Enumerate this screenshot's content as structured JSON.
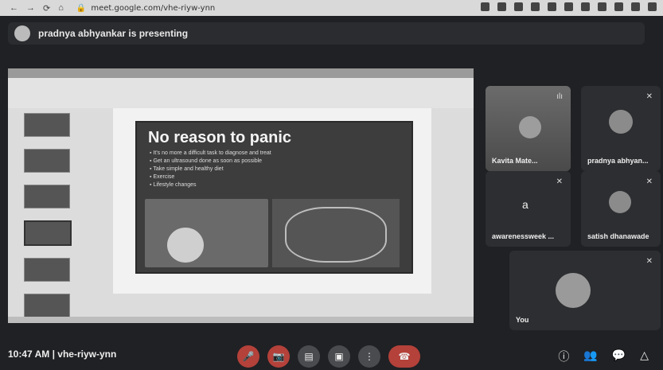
{
  "browser": {
    "url": "meet.google.com/vhe-riyw-ynn"
  },
  "meet": {
    "presenting_banner": "pradnya abhyankar is presenting",
    "slide": {
      "title": "No reason to panic",
      "bullets": [
        "It's no more a difficult task to diagnose and treat",
        "Get an ultrasound done as soon as possible",
        "Take simple and healthy diet",
        "Exercise",
        "Lifestyle changes"
      ]
    },
    "participants": [
      {
        "name": "Kavita Mate..."
      },
      {
        "name": "pradnya abhyan..."
      },
      {
        "name": "awarenessweek ...",
        "initial": "a"
      },
      {
        "name": "satish dhanawade"
      },
      {
        "name": "You"
      }
    ],
    "bottom_bar": {
      "time": "10:47 AM",
      "separator": "|",
      "meeting_code": "vhe-riyw-ynn"
    }
  }
}
